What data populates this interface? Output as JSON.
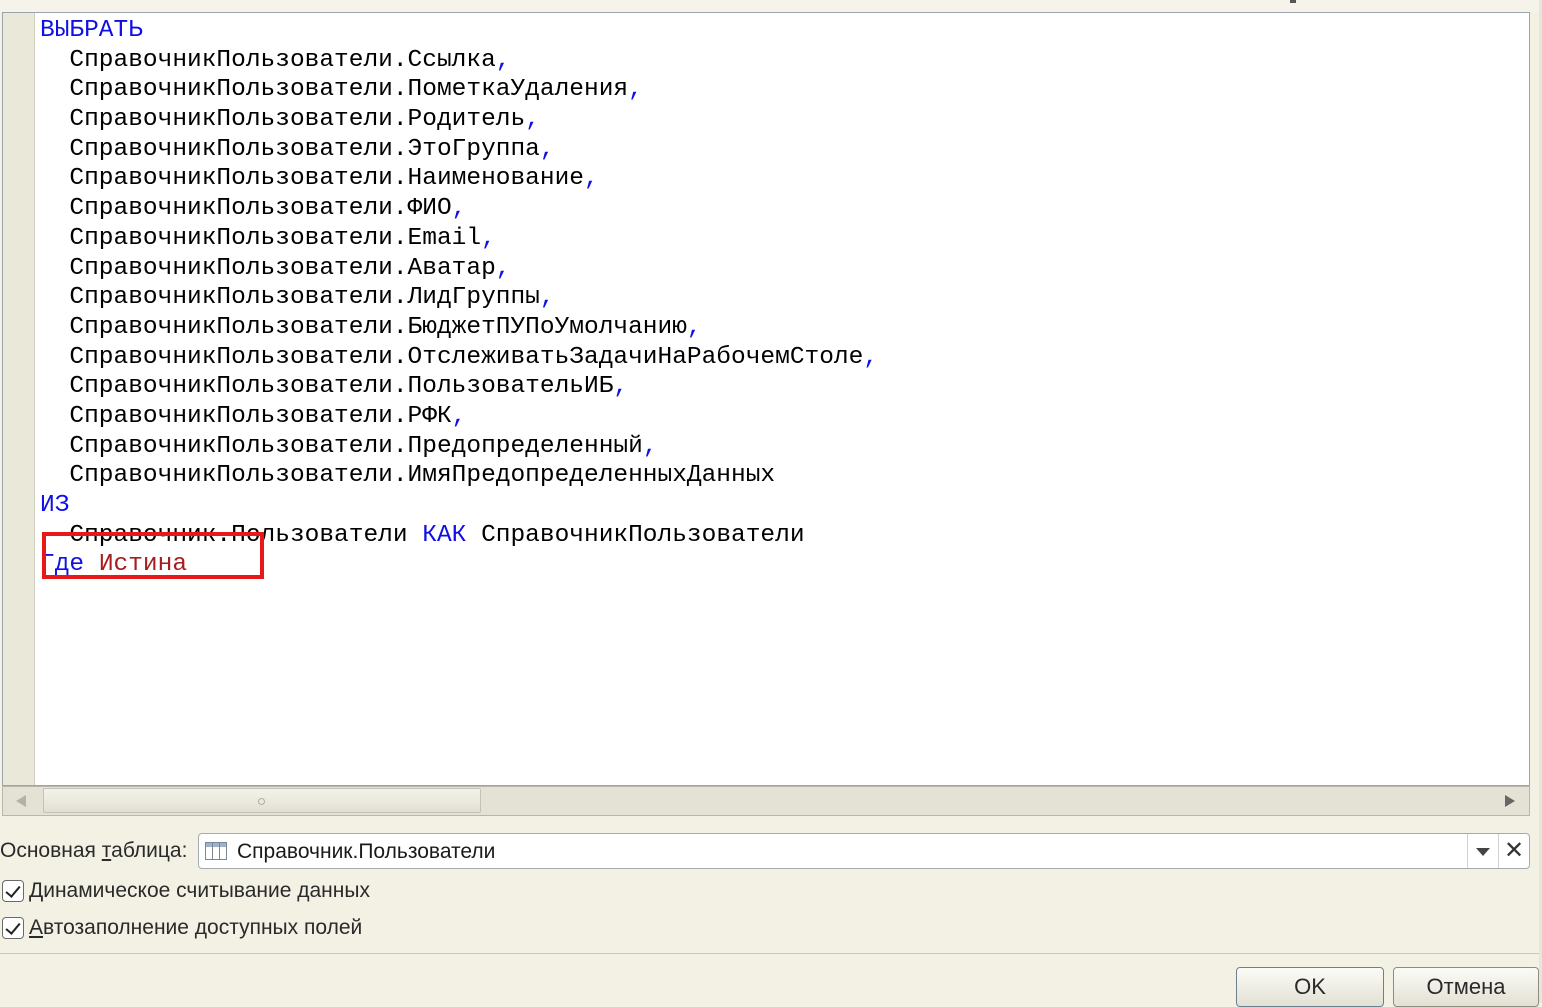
{
  "editor": {
    "lines": [
      [
        {
          "t": "ВЫБРАТЬ",
          "c": "kw"
        }
      ],
      [
        {
          "t": "  СправочникПользователи.Ссылка"
        },
        {
          "t": ",",
          "c": "pc"
        }
      ],
      [
        {
          "t": "  СправочникПользователи.ПометкаУдаления"
        },
        {
          "t": ",",
          "c": "pc"
        }
      ],
      [
        {
          "t": "  СправочникПользователи.Родитель"
        },
        {
          "t": ",",
          "c": "pc"
        }
      ],
      [
        {
          "t": "  СправочникПользователи.ЭтоГруппа"
        },
        {
          "t": ",",
          "c": "pc"
        }
      ],
      [
        {
          "t": "  СправочникПользователи.Наименование"
        },
        {
          "t": ",",
          "c": "pc"
        }
      ],
      [
        {
          "t": "  СправочникПользователи.ФИО"
        },
        {
          "t": ",",
          "c": "pc"
        }
      ],
      [
        {
          "t": "  СправочникПользователи.Email"
        },
        {
          "t": ",",
          "c": "pc"
        }
      ],
      [
        {
          "t": "  СправочникПользователи.Аватар"
        },
        {
          "t": ",",
          "c": "pc"
        }
      ],
      [
        {
          "t": "  СправочникПользователи.ЛидГруппы"
        },
        {
          "t": ",",
          "c": "pc"
        }
      ],
      [
        {
          "t": "  СправочникПользователи.БюджетПУПоУмолчанию"
        },
        {
          "t": ",",
          "c": "pc"
        }
      ],
      [
        {
          "t": "  СправочникПользователи.ОтслеживатьЗадачиНаРабочемСтоле"
        },
        {
          "t": ",",
          "c": "pc"
        }
      ],
      [
        {
          "t": "  СправочникПользователи.ПользовательИБ"
        },
        {
          "t": ",",
          "c": "pc"
        }
      ],
      [
        {
          "t": "  СправочникПользователи.РФК"
        },
        {
          "t": ",",
          "c": "pc"
        }
      ],
      [
        {
          "t": "  СправочникПользователи.Предопределенный"
        },
        {
          "t": ",",
          "c": "pc"
        }
      ],
      [
        {
          "t": "  СправочникПользователи.ИмяПредопределенныхДанных"
        }
      ],
      [
        {
          "t": "ИЗ",
          "c": "kw"
        }
      ],
      [
        {
          "t": "  Справочник.Пользователи "
        },
        {
          "t": "КАК",
          "c": "kw"
        },
        {
          "t": " СправочникПользователи"
        }
      ],
      [
        {
          "t": "Где",
          "c": "kw"
        },
        {
          "t": " "
        },
        {
          "t": "Истина",
          "c": "lit"
        }
      ]
    ]
  },
  "main_table": {
    "label_pre": "Основная ",
    "label_underlined": "т",
    "label_post": "аблица:",
    "value": "Справочник.Пользователи",
    "clear_glyph": "✕"
  },
  "checkboxes": [
    {
      "underlined": "Д",
      "rest": "инамическое считывание данных",
      "checked": true
    },
    {
      "underlined": "А",
      "rest": "втозаполнение доступных полей",
      "checked": true
    }
  ],
  "buttons": {
    "ok": "OK",
    "cancel": "Отмена"
  },
  "colors": {
    "keyword": "#1010e6",
    "literal": "#a51d1d",
    "highlight": "#e81818"
  }
}
